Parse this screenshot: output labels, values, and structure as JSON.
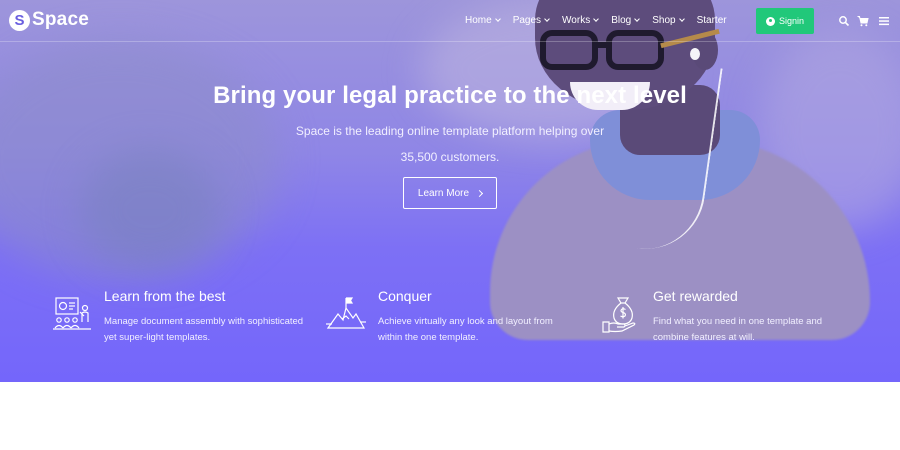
{
  "brand": {
    "badge": "S",
    "name": "Space"
  },
  "nav": {
    "items": [
      {
        "label": "Home",
        "has_dropdown": true
      },
      {
        "label": "Pages",
        "has_dropdown": true
      },
      {
        "label": "Works",
        "has_dropdown": true
      },
      {
        "label": "Blog",
        "has_dropdown": true
      },
      {
        "label": "Shop",
        "has_dropdown": true
      },
      {
        "label": "Starter",
        "has_dropdown": false
      }
    ],
    "signin_label": "Signin",
    "icons": [
      "search-icon",
      "cart-icon",
      "menu-icon"
    ]
  },
  "hero": {
    "title": "Bring your legal practice to the next level",
    "subtitle": "Space is the leading online template platform helping over 35,500 customers.",
    "cta_label": "Learn More"
  },
  "features": [
    {
      "icon": "presentation-icon",
      "title": "Learn from the best",
      "description": "Manage document assembly with sophisticated yet super-light templates."
    },
    {
      "icon": "mountain-flag-icon",
      "title": "Conquer",
      "description": "Achieve virtually any look and layout from within the one template."
    },
    {
      "icon": "money-bag-icon",
      "title": "Get rewarded",
      "description": "Find what you need in one template and combine features at will."
    }
  ],
  "colors": {
    "accent": "#7466fb",
    "signin": "#21c87a",
    "text_on_hero": "#ffffff"
  }
}
